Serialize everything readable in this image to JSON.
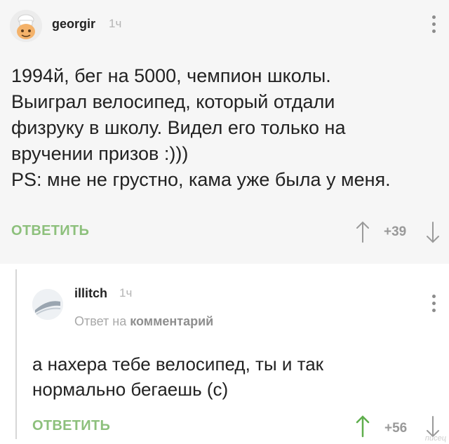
{
  "comments": [
    {
      "username": "georgir",
      "time": "1ч",
      "lines": [
        "1994й, бег на 5000, чемпион школы.",
        "Выиграл велосипед, который отдали",
        "физруку в школу. Видел его только на",
        "вручении призов :)))",
        "PS: мне не грустно, кама уже была у меня."
      ],
      "reply_label": "ОТВЕТИТЬ",
      "rating": "+39",
      "avatar_icon": "chef-avatar-icon"
    },
    {
      "username": "illitch",
      "time": "1ч",
      "reply_to_prefix": "Ответ на",
      "reply_to_target": "комментарий",
      "lines": [
        "а нахера тебе велосипед, ты и так",
        "нормально бегаешь (с)"
      ],
      "reply_label": "ОТВЕТИТЬ",
      "rating": "+56",
      "avatar_icon": "wing-avatar-icon"
    }
  ],
  "watermark": "писец",
  "colors": {
    "accent_green": "#8dc07c",
    "upvote_green": "#5fae4d",
    "arrow_gray": "#9a9a9a"
  }
}
